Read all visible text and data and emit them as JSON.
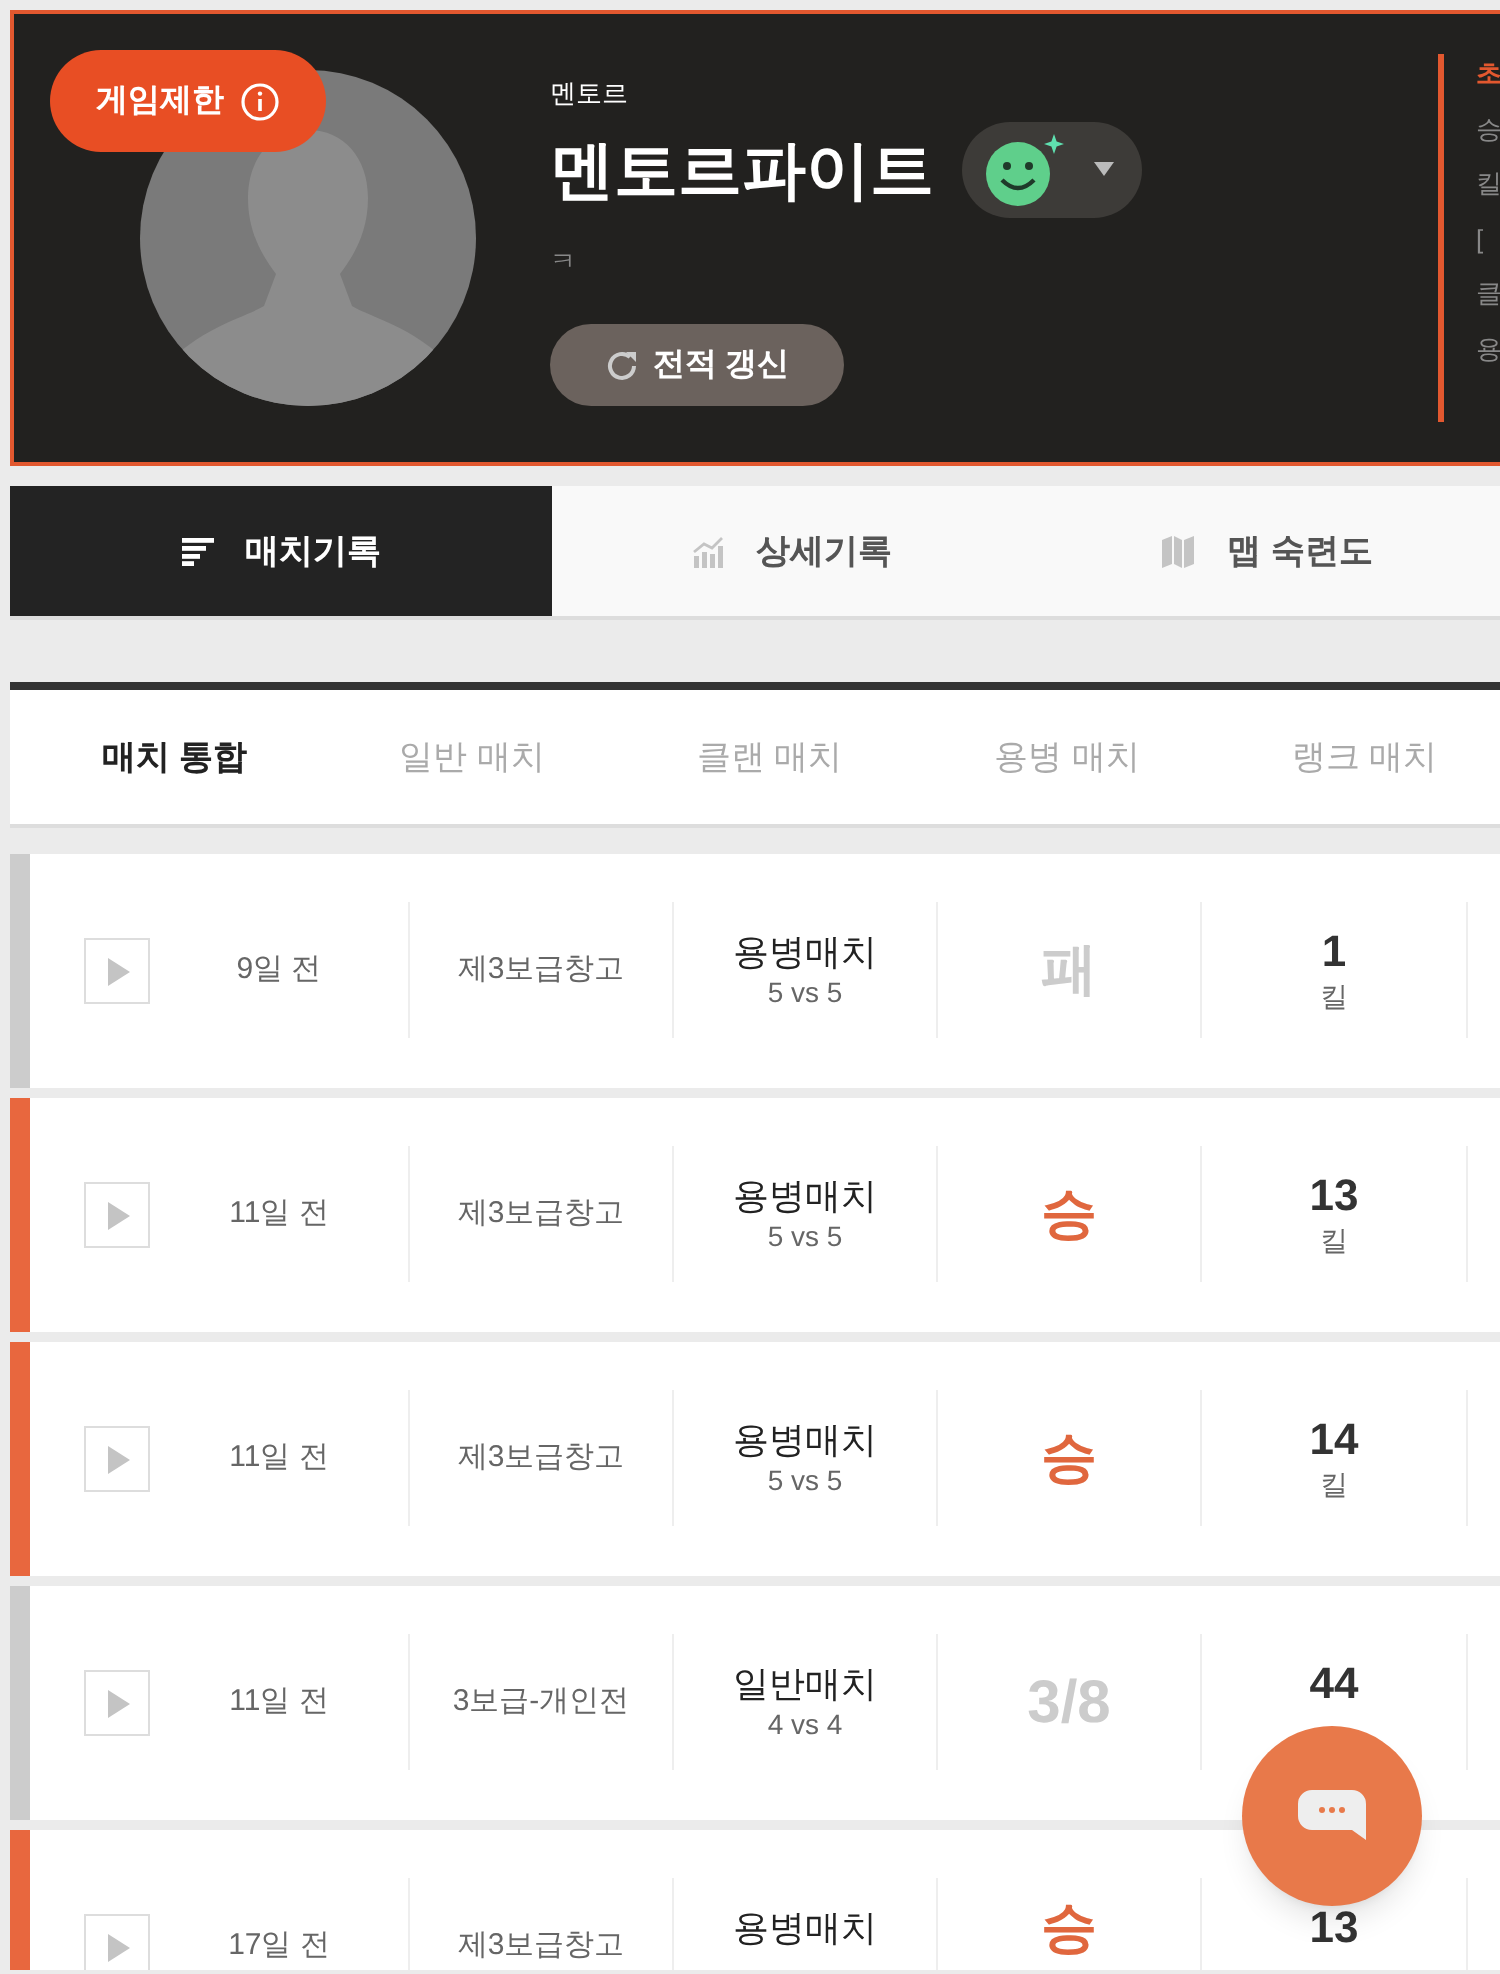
{
  "profile": {
    "restriction_badge": "게임제한",
    "title_label": "멘토르",
    "nickname": "멘토르파이트",
    "status_message": "ㅋ",
    "refresh_button": "전적 갱신",
    "side_panel": [
      "초",
      "승",
      "킬",
      "[",
      "클",
      "용"
    ]
  },
  "tabs": [
    {
      "label": "매치기록",
      "selected": true
    },
    {
      "label": "상세기록",
      "selected": false
    },
    {
      "label": "맵 숙련도",
      "selected": false
    }
  ],
  "filters": [
    {
      "label": "매치 통합",
      "selected": true
    },
    {
      "label": "일반 매치",
      "selected": false
    },
    {
      "label": "클랜 매치",
      "selected": false
    },
    {
      "label": "용병 매치",
      "selected": false
    },
    {
      "label": "랭크 매치",
      "selected": false
    }
  ],
  "matches": [
    {
      "time": "9일 전",
      "map": "제3보급창고",
      "mode": "용병매치",
      "size": "5 vs 5",
      "result": "패",
      "kind": "loss",
      "kills": "1",
      "kills_label": "킬"
    },
    {
      "time": "11일 전",
      "map": "제3보급창고",
      "mode": "용병매치",
      "size": "5 vs 5",
      "result": "승",
      "kind": "win",
      "kills": "13",
      "kills_label": "킬"
    },
    {
      "time": "11일 전",
      "map": "제3보급창고",
      "mode": "용병매치",
      "size": "5 vs 5",
      "result": "승",
      "kind": "win",
      "kills": "14",
      "kills_label": "킬"
    },
    {
      "time": "11일 전",
      "map": "3보급-개인전",
      "mode": "일반매치",
      "size": "4 vs 4",
      "result": "3/8",
      "kind": "rank",
      "kills": "44"
    },
    {
      "time": "17일 전",
      "map": "제3보급창고",
      "mode": "용병매치",
      "result": "승",
      "kind": "win",
      "kills": "13"
    }
  ]
}
